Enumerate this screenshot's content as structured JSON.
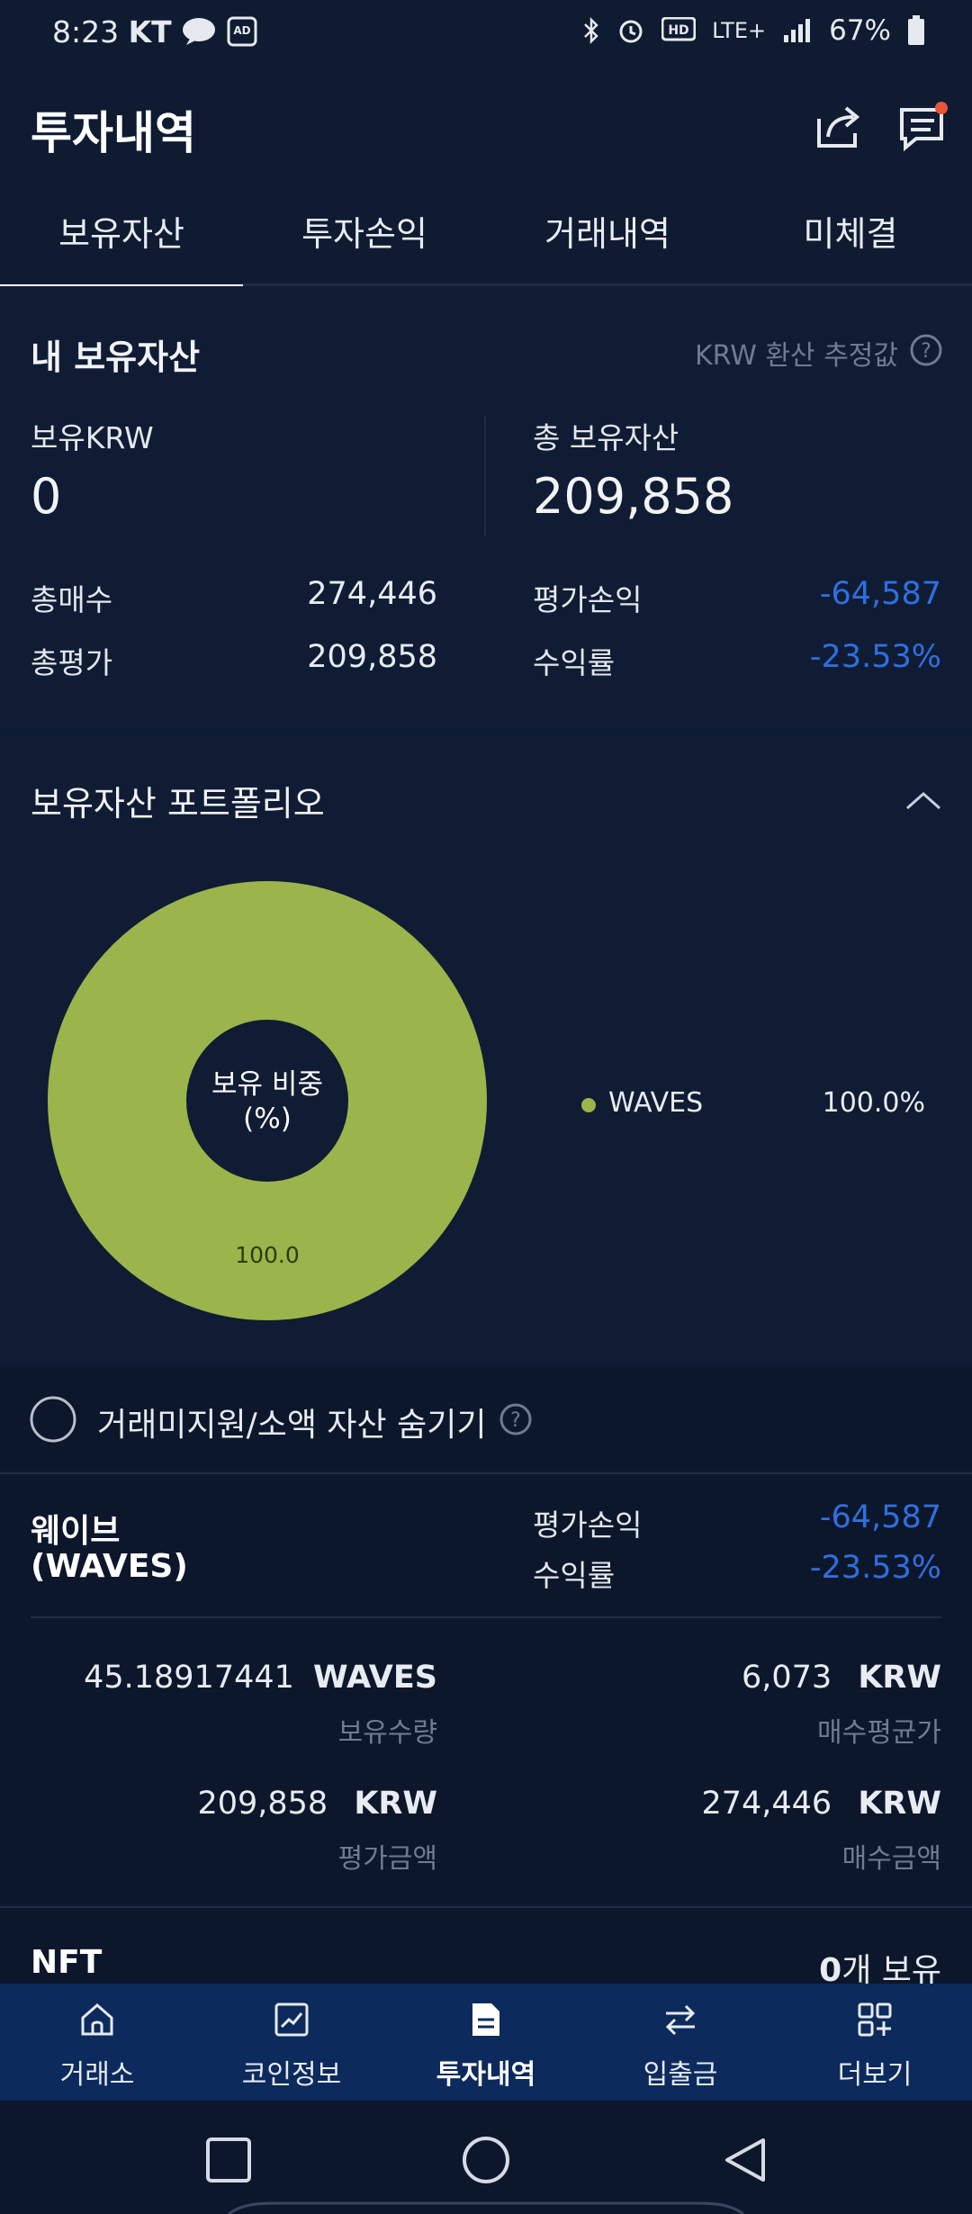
{
  "status_bar": {
    "time": "8:23",
    "carrier": "KT",
    "battery": "67%",
    "network": "LTE+"
  },
  "header": {
    "title": "투자내역"
  },
  "tabs": [
    {
      "label": "보유자산",
      "active": true
    },
    {
      "label": "투자손익",
      "active": false
    },
    {
      "label": "거래내역",
      "active": false
    },
    {
      "label": "미체결",
      "active": false
    }
  ],
  "summary": {
    "title": "내 보유자산",
    "estimate_note": "KRW 환산 추정값",
    "krw_label": "보유KRW",
    "krw_value": "0",
    "total_label": "총 보유자산",
    "total_value": "209,858",
    "rows": [
      {
        "label": "총매수",
        "value": "274,446"
      },
      {
        "label": "총평가",
        "value": "209,858"
      },
      {
        "label": "평가손익",
        "value": "-64,587"
      },
      {
        "label": "수익률",
        "value": "-23.53%"
      }
    ]
  },
  "portfolio": {
    "title": "보유자산 포트폴리오",
    "donut_center": [
      "보유 비중",
      "(%)"
    ],
    "donut_label": "100.0",
    "legend_name": "WAVES",
    "legend_value": "100.0%"
  },
  "chart_data": {
    "type": "pie",
    "categories": [
      "WAVES"
    ],
    "values": [
      100.0
    ],
    "colors": [
      "#9bb44b"
    ],
    "legend": "right"
  },
  "hide_small": {
    "label": "거래미지원/소액 자산 숨기기"
  },
  "asset": {
    "name_kr": "웨이브",
    "name_en": "(WAVES)",
    "pl_label": "평가손익",
    "pl_value": "-64,587",
    "rate_label": "수익률",
    "rate_value": "-23.53%",
    "qty_value": "45.18917441",
    "qty_unit": "WAVES",
    "qty_label": "보유수량",
    "avg_value": "6,073",
    "avg_unit": "KRW",
    "avg_label": "매수평균가",
    "eval_value": "209,858",
    "eval_unit": "KRW",
    "eval_label": "평가금액",
    "buy_value": "274,446",
    "buy_unit": "KRW",
    "buy_label": "매수금액"
  },
  "nft": {
    "label": "NFT",
    "count": "0",
    "count_suffix": "개 보유"
  },
  "bottom_nav": [
    {
      "label": "거래소",
      "icon": "home-icon"
    },
    {
      "label": "코인정보",
      "icon": "chart-icon"
    },
    {
      "label": "투자내역",
      "icon": "document-icon",
      "active": true
    },
    {
      "label": "입출금",
      "icon": "transfer-icon"
    },
    {
      "label": "더보기",
      "icon": "more-grid-icon"
    }
  ]
}
